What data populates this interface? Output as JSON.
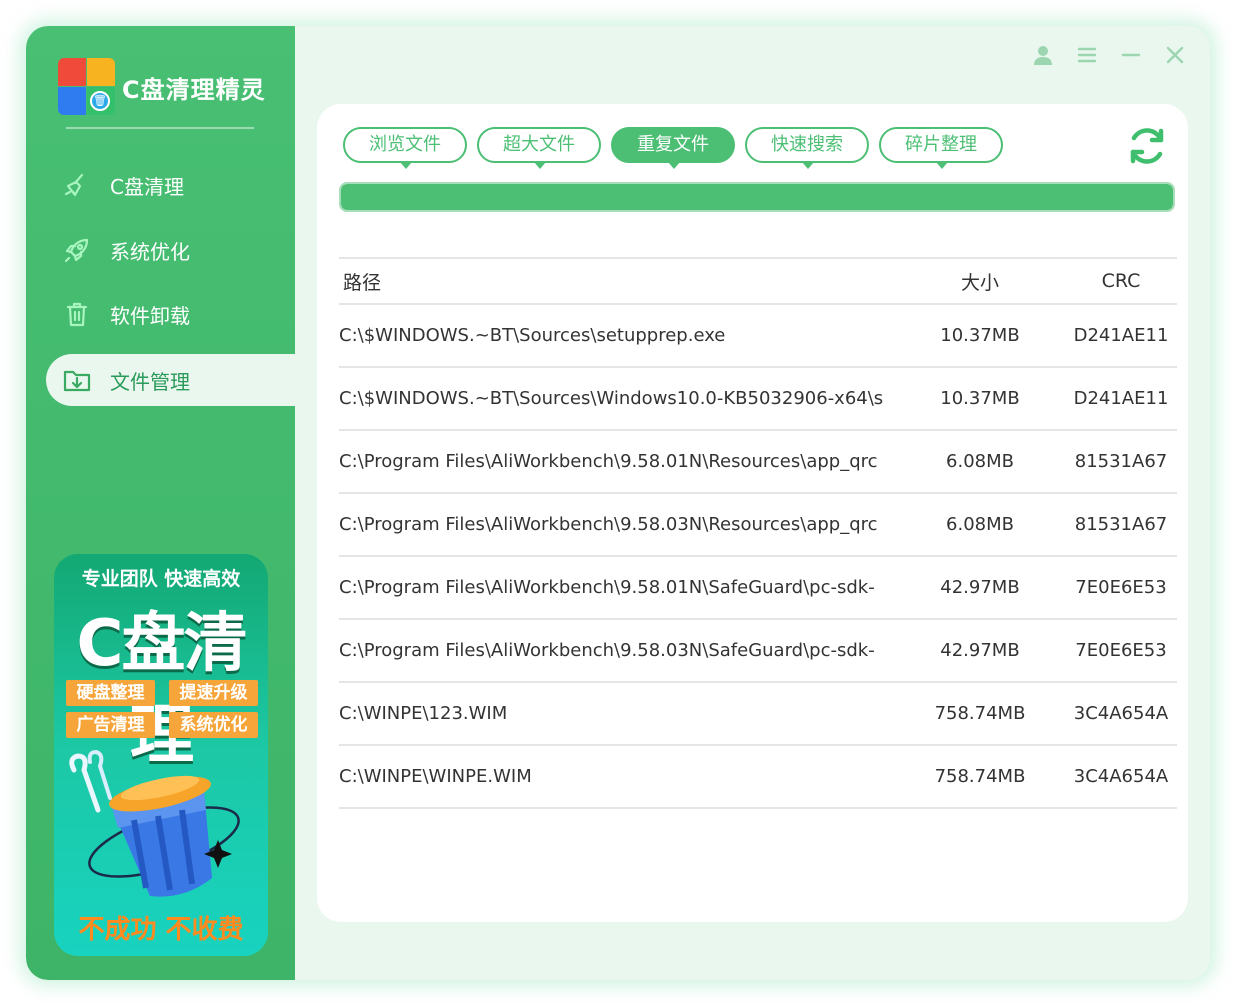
{
  "app": {
    "title": "C盘清理精灵",
    "logo_badge": "🗑"
  },
  "sidebar": {
    "items": [
      {
        "label": "C盘清理",
        "icon": "broom-icon",
        "active": false
      },
      {
        "label": "系统优化",
        "icon": "rocket-icon",
        "active": false
      },
      {
        "label": "软件卸载",
        "icon": "trash-icon",
        "active": false
      },
      {
        "label": "文件管理",
        "icon": "folder-download-icon",
        "active": true
      }
    ]
  },
  "promo": {
    "tagline": "专业团队 快速高效",
    "headline": "C盘清理",
    "features": [
      "硬盘整理",
      "提速升级",
      "广告清理",
      "系统优化"
    ],
    "footer": "不成功 不收费"
  },
  "window_controls": [
    "user-icon",
    "menu-icon",
    "minimize-icon",
    "close-icon"
  ],
  "tabs": [
    {
      "label": "浏览文件",
      "active": false
    },
    {
      "label": "超大文件",
      "active": false
    },
    {
      "label": "重复文件",
      "active": true
    },
    {
      "label": "快速搜索",
      "active": false
    },
    {
      "label": "碎片整理",
      "active": false
    }
  ],
  "progress": {
    "value": 1.0
  },
  "table": {
    "headers": {
      "path": "路径",
      "size": "大小",
      "crc": "CRC"
    },
    "rows": [
      {
        "path": "C:\\$WINDOWS.~BT\\Sources\\setupprep.exe",
        "size": "10.37MB",
        "crc": "D241AE11"
      },
      {
        "path": "C:\\$WINDOWS.~BT\\Sources\\Windows10.0-KB5032906-x64\\s",
        "size": "10.37MB",
        "crc": "D241AE11"
      },
      {
        "path": "C:\\Program Files\\AliWorkbench\\9.58.01N\\Resources\\app_qrc",
        "size": "6.08MB",
        "crc": "81531A67"
      },
      {
        "path": "C:\\Program Files\\AliWorkbench\\9.58.03N\\Resources\\app_qrc",
        "size": "6.08MB",
        "crc": "81531A67"
      },
      {
        "path": "C:\\Program Files\\AliWorkbench\\9.58.01N\\SafeGuard\\pc-sdk-",
        "size": "42.97MB",
        "crc": "7E0E6E53"
      },
      {
        "path": "C:\\Program Files\\AliWorkbench\\9.58.03N\\SafeGuard\\pc-sdk-",
        "size": "42.97MB",
        "crc": "7E0E6E53"
      },
      {
        "path": "C:\\WINPE\\123.WIM",
        "size": "758.74MB",
        "crc": "3C4A654A"
      },
      {
        "path": "C:\\WINPE\\WINPE.WIM",
        "size": "758.74MB",
        "crc": "3C4A654A"
      }
    ]
  },
  "colors": {
    "accent": "#4cbf74",
    "sidebar": "#45bb6f",
    "background": "#eaf7ee"
  }
}
